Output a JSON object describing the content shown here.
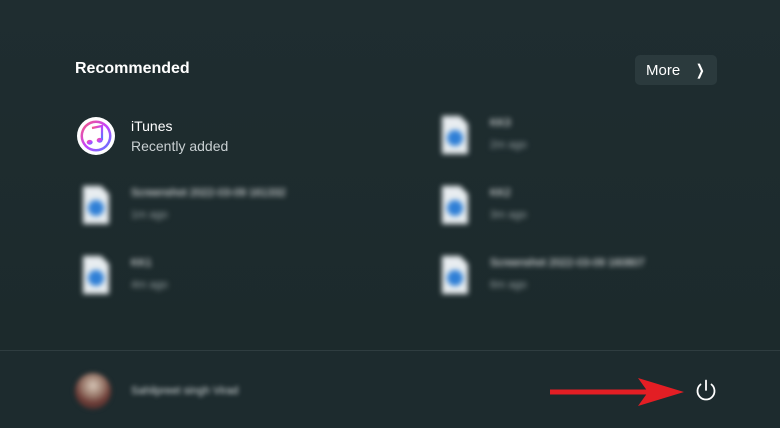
{
  "recommended": {
    "title": "Recommended",
    "more_label": "More",
    "items": [
      {
        "name": "iTunes",
        "sub": "Recently added",
        "icon": "itunes-icon"
      },
      {
        "name": "Screenshot 2022-03-09 161332",
        "sub": "1m ago",
        "icon": "image-file-icon"
      },
      {
        "name": "KK1",
        "sub": "4m ago",
        "icon": "image-file-icon"
      },
      {
        "name": "KK3",
        "sub": "2m ago",
        "icon": "image-file-icon"
      },
      {
        "name": "KK2",
        "sub": "3m ago",
        "icon": "image-file-icon"
      },
      {
        "name": "Screenshot 2022-03-09 160807",
        "sub": "6m ago",
        "icon": "image-file-icon"
      }
    ]
  },
  "user": {
    "name": "Sahilpreet singh Virad"
  },
  "power": {
    "icon": "power-icon"
  },
  "colors": {
    "background": "#1e2c2f",
    "button": "#2b3a3d",
    "arrow": "#e31e24"
  }
}
